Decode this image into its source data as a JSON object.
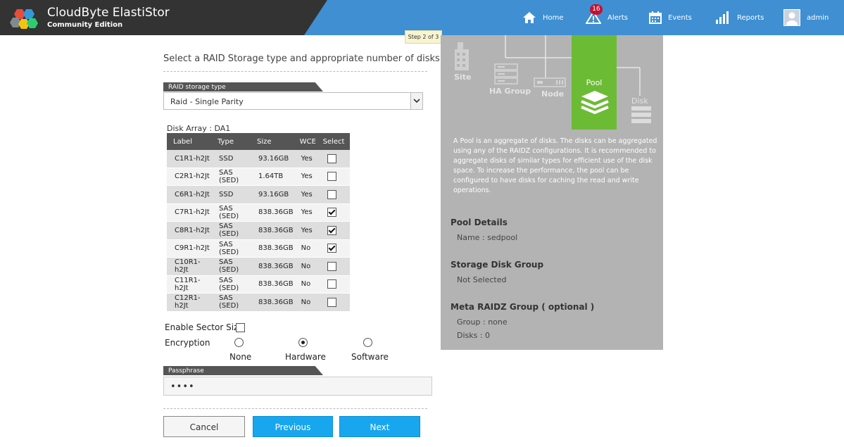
{
  "header": {
    "brand_name": "CloudByte ElastiStor",
    "edition": "Community Edition",
    "nav": {
      "home": "Home",
      "alerts": "Alerts",
      "alerts_count": "16",
      "events": "Events",
      "reports": "Reports",
      "admin": "admin"
    },
    "icons": [
      "logo-icon",
      "home-icon",
      "alert-icon",
      "calendar-icon",
      "bar-chart-icon",
      "user-icon"
    ],
    "bar_color": "#3f8fd2",
    "brand_color": "#333333"
  },
  "wizard": {
    "step": "Step 2 of 3",
    "instruction": "Select a RAID Storage type and appropriate number of disks.",
    "raid_label": "RAID storage type",
    "raid_value": "Raid - Single Parity",
    "disk_array_label": "Disk Array : DA1",
    "table": {
      "headers": {
        "label": "Label",
        "type": "Type",
        "size": "Size",
        "wce": "WCE",
        "select": "Select"
      },
      "rows": [
        {
          "label": "C1R1-h2Jt",
          "type": "SSD",
          "size": "93.16GB",
          "wce": "Yes",
          "selected": false
        },
        {
          "label": "C2R1-h2Jt",
          "type": "SAS (SED)",
          "size": "1.64TB",
          "wce": "Yes",
          "selected": false
        },
        {
          "label": "C6R1-h2Jt",
          "type": "SSD",
          "size": "93.16GB",
          "wce": "Yes",
          "selected": false
        },
        {
          "label": "C7R1-h2Jt",
          "type": "SAS (SED)",
          "size": "838.36GB",
          "wce": "Yes",
          "selected": true
        },
        {
          "label": "C8R1-h2Jt",
          "type": "SAS (SED)",
          "size": "838.36GB",
          "wce": "Yes",
          "selected": true
        },
        {
          "label": "C9R1-h2Jt",
          "type": "SAS (SED)",
          "size": "838.36GB",
          "wce": "No",
          "selected": true
        },
        {
          "label": "C10R1-h2Jt",
          "type": "SAS (SED)",
          "size": "838.36GB",
          "wce": "No",
          "selected": false
        },
        {
          "label": "C11R1-h2Jt",
          "type": "SAS (SED)",
          "size": "838.36GB",
          "wce": "No",
          "selected": false
        },
        {
          "label": "C12R1-h2Jt",
          "type": "SAS (SED)",
          "size": "838.36GB",
          "wce": "No",
          "selected": false
        }
      ]
    },
    "enable_sector_size": "Enable Sector Size",
    "enable_sector_size_checked": false,
    "encryption_label": "Encryption",
    "encryption_options": [
      "None",
      "Hardware",
      "Software"
    ],
    "encryption_selected": "Hardware",
    "passphrase_label": "Passphrase",
    "passphrase_value": "••••",
    "buttons": {
      "cancel": "Cancel",
      "previous": "Previous",
      "next": "Next"
    },
    "button_color": "#18a7ee"
  },
  "info": {
    "hierarchy": {
      "site": "Site",
      "ha_group": "HA Group",
      "node": "Node",
      "pool": "Pool",
      "disk": "Disk"
    },
    "pool_color": "#6cbb35",
    "description": "A Pool is an aggregate of disks. The disks can be aggregated using any of the RAIDZ configurations. It is recommended to aggregate disks of similar types for efficient use of the disk space. To increase the performance, the pool can be configured to have disks for caching the read and write operations.",
    "pool_details_title": "Pool Details",
    "pool_name": "Name : sedpool",
    "storage_group_title": "Storage Disk Group",
    "storage_group_value": "Not Selected",
    "meta_title": "Meta RAIDZ Group ( optional )",
    "meta_group": "Group : none",
    "meta_disks": "Disks : 0"
  }
}
